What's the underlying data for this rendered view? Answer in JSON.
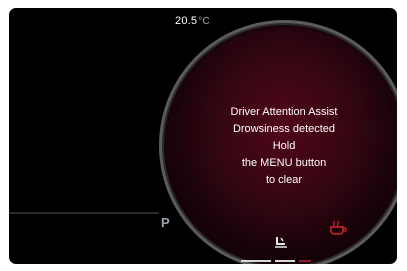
{
  "cluster": {
    "outside_temperature": "20.5",
    "temperature_unit": "°C",
    "gear": "P",
    "message": {
      "line1": "Driver Attention Assist",
      "line2": "Drowsiness detected",
      "line3": "Hold",
      "line4": "the MENU button",
      "line5": "to clear"
    },
    "icons": {
      "coffee": "coffee-cup-icon",
      "seat": "seat-adjust-icon"
    },
    "accent_color": "#d6262e"
  }
}
